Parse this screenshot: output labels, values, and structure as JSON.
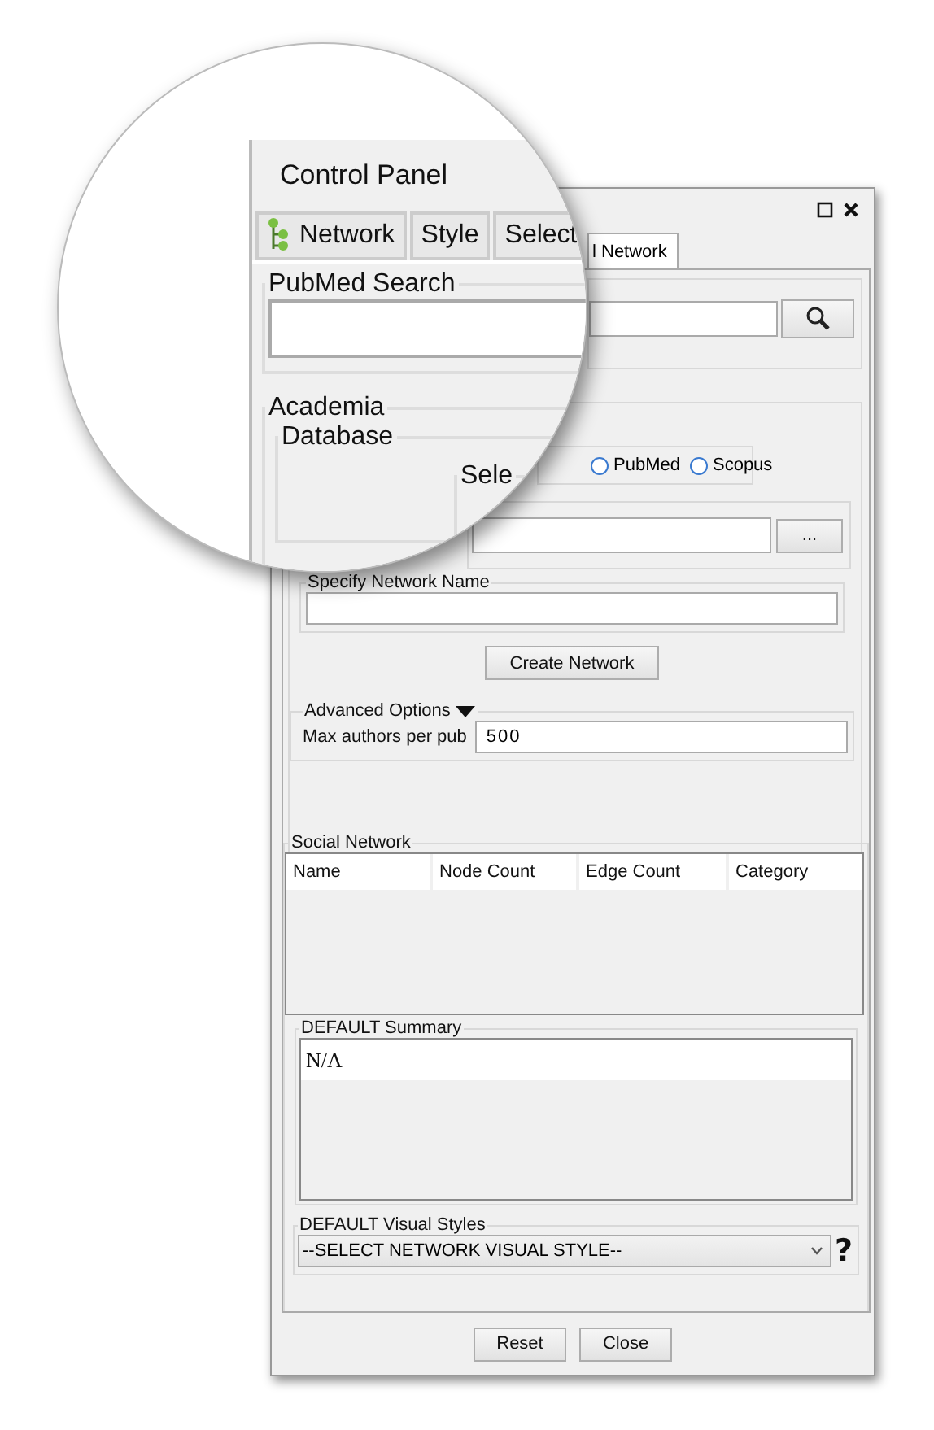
{
  "magnifier": {
    "title": "Control Panel",
    "tabs": [
      {
        "label": "Network",
        "selected": false
      },
      {
        "label": "Style",
        "selected": false
      },
      {
        "label": "Select",
        "selected": false
      }
    ],
    "search_group": "PubMed Search",
    "group": "Academia",
    "subgroup": "Database",
    "cut_group": "Sele"
  },
  "tabs": [
    {
      "label": "l Network",
      "selected": true
    }
  ],
  "database": {
    "radios": [
      {
        "label": "PubMed",
        "selected": false
      },
      {
        "label": "Scopus",
        "selected": false
      }
    ],
    "browse_button": "...",
    "network_name_label": "Specify Network Name",
    "create_button": "Create Network"
  },
  "advanced_options": {
    "title": "Advanced Options",
    "expanded": true,
    "max_authors_label": "Max authors per pub",
    "max_authors_value": "500"
  },
  "social_network": {
    "title": "Social Network",
    "columns": [
      "Name",
      "Node Count",
      "Edge Count",
      "Category"
    ]
  },
  "summary": {
    "title": "DEFAULT Summary",
    "text": "N/A"
  },
  "visual_styles": {
    "title": "DEFAULT Visual Styles",
    "value": "--SELECT NETWORK VISUAL STYLE--",
    "help": "?"
  },
  "buttons": [
    "Reset",
    "Close"
  ]
}
